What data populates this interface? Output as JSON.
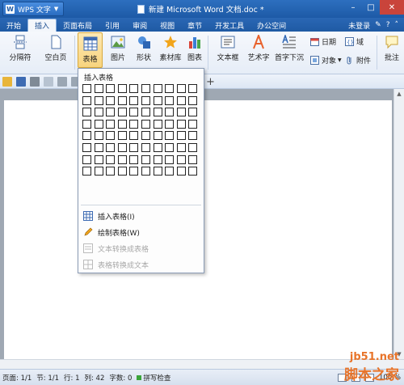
{
  "titlebar": {
    "app_menu": "WPS 文字",
    "doc_title": "新建 Microsoft Word 文档.doc *"
  },
  "menubar": {
    "tabs": [
      "开始",
      "插入",
      "页面布局",
      "引用",
      "审阅",
      "视图",
      "章节",
      "开发工具",
      "办公空间"
    ],
    "active_tab": "插入",
    "login": "未登录"
  },
  "ribbon": {
    "page_break": "分隔符",
    "blank_page": "空白页",
    "table": "表格",
    "picture": "图片",
    "shape": "形状",
    "asset_library": "素材库",
    "chart": "图表",
    "textbox": "文本框",
    "art_text": "艺术字",
    "drop_cap": "首字下沉",
    "date": "日期",
    "object": "对象",
    "field": "域",
    "attachment": "附件",
    "comment": "批注"
  },
  "dropdown": {
    "header": "插入表格",
    "items": [
      {
        "label": "插入表格(I)",
        "enabled": true
      },
      {
        "label": "绘制表格(W)",
        "enabled": true
      },
      {
        "label": "文本转换成表格",
        "enabled": false
      },
      {
        "label": "表格转换成文本",
        "enabled": false
      }
    ],
    "grid_rows": 8,
    "grid_cols": 10
  },
  "statusbar": {
    "page": "页面: 1/1",
    "section": "节: 1/1",
    "line": "行: 1",
    "column": "列: 42",
    "word_count": "字数: 0",
    "spell_check": "拼写检查",
    "zoom": "100 %"
  },
  "watermark": {
    "top": "jb51.net",
    "bottom": "脚本之家"
  },
  "colors": {
    "title_bar": "#1d5aa6",
    "ribbon": "#eef3fa",
    "selected": "#f8d47e",
    "watermark": "#e8742a"
  }
}
